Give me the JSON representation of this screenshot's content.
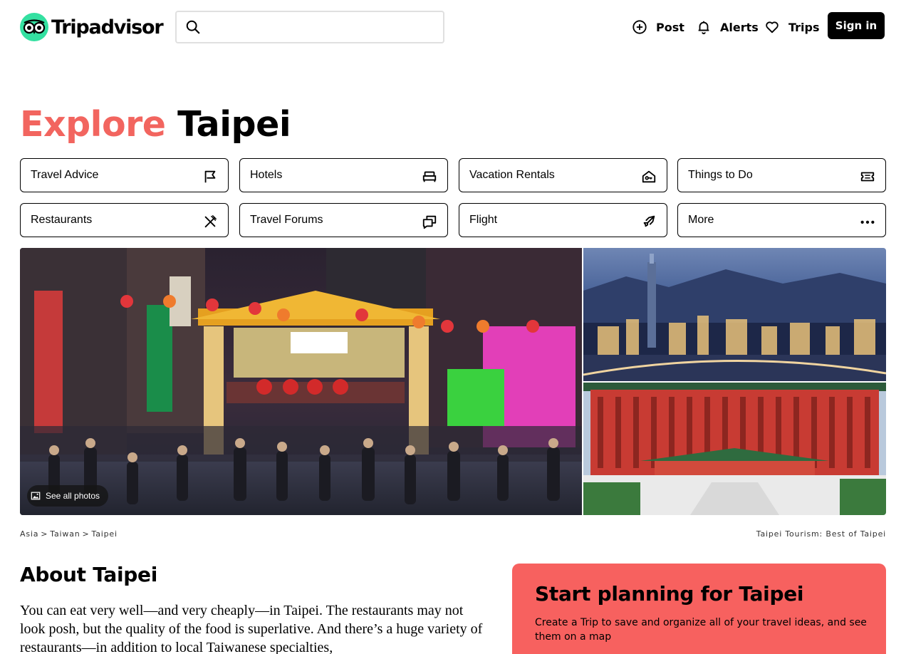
{
  "header": {
    "logo_text": "Tripadvisor",
    "search_placeholder": "",
    "nav": {
      "post": "Post",
      "alerts": "Alerts",
      "trips": "Trips",
      "sign_in": "Sign in"
    }
  },
  "page": {
    "title_accent": "Explore",
    "title_city": "Taipei"
  },
  "categories": [
    {
      "label": "Travel Advice",
      "icon": "flag-icon"
    },
    {
      "label": "Hotels",
      "icon": "bed-icon"
    },
    {
      "label": "Vacation Rentals",
      "icon": "house-key-icon"
    },
    {
      "label": "Things to Do",
      "icon": "ticket-icon"
    },
    {
      "label": "Restaurants",
      "icon": "utensils-icon"
    },
    {
      "label": "Travel Forums",
      "icon": "chat-bubbles-icon"
    },
    {
      "label": "Flight",
      "icon": "airplane-icon"
    },
    {
      "label": "More",
      "icon": "more-dots-icon"
    }
  ],
  "photos": {
    "see_all": "See all photos"
  },
  "breadcrumb": [
    "Asia",
    "Taiwan",
    "Taipei"
  ],
  "breadcrumb_separator": ">",
  "tourism_label": "Taipei Tourism: Best of Taipei",
  "about": {
    "heading": "About Taipei",
    "text": "You can eat very well—and very cheaply—in Taipei. The restaurants may not look posh, but the quality of the food is superlative. And there’s a huge variety of restaurants—in addition to local Taiwanese specialties,"
  },
  "plan": {
    "heading": "Start planning for Taipei",
    "text": "Create a Trip to save and organize all of your travel ideas, and see them on a map"
  },
  "colors": {
    "accent": "#f2655f",
    "logo_green": "#34e0a1",
    "plan_bg": "#f7615f"
  }
}
